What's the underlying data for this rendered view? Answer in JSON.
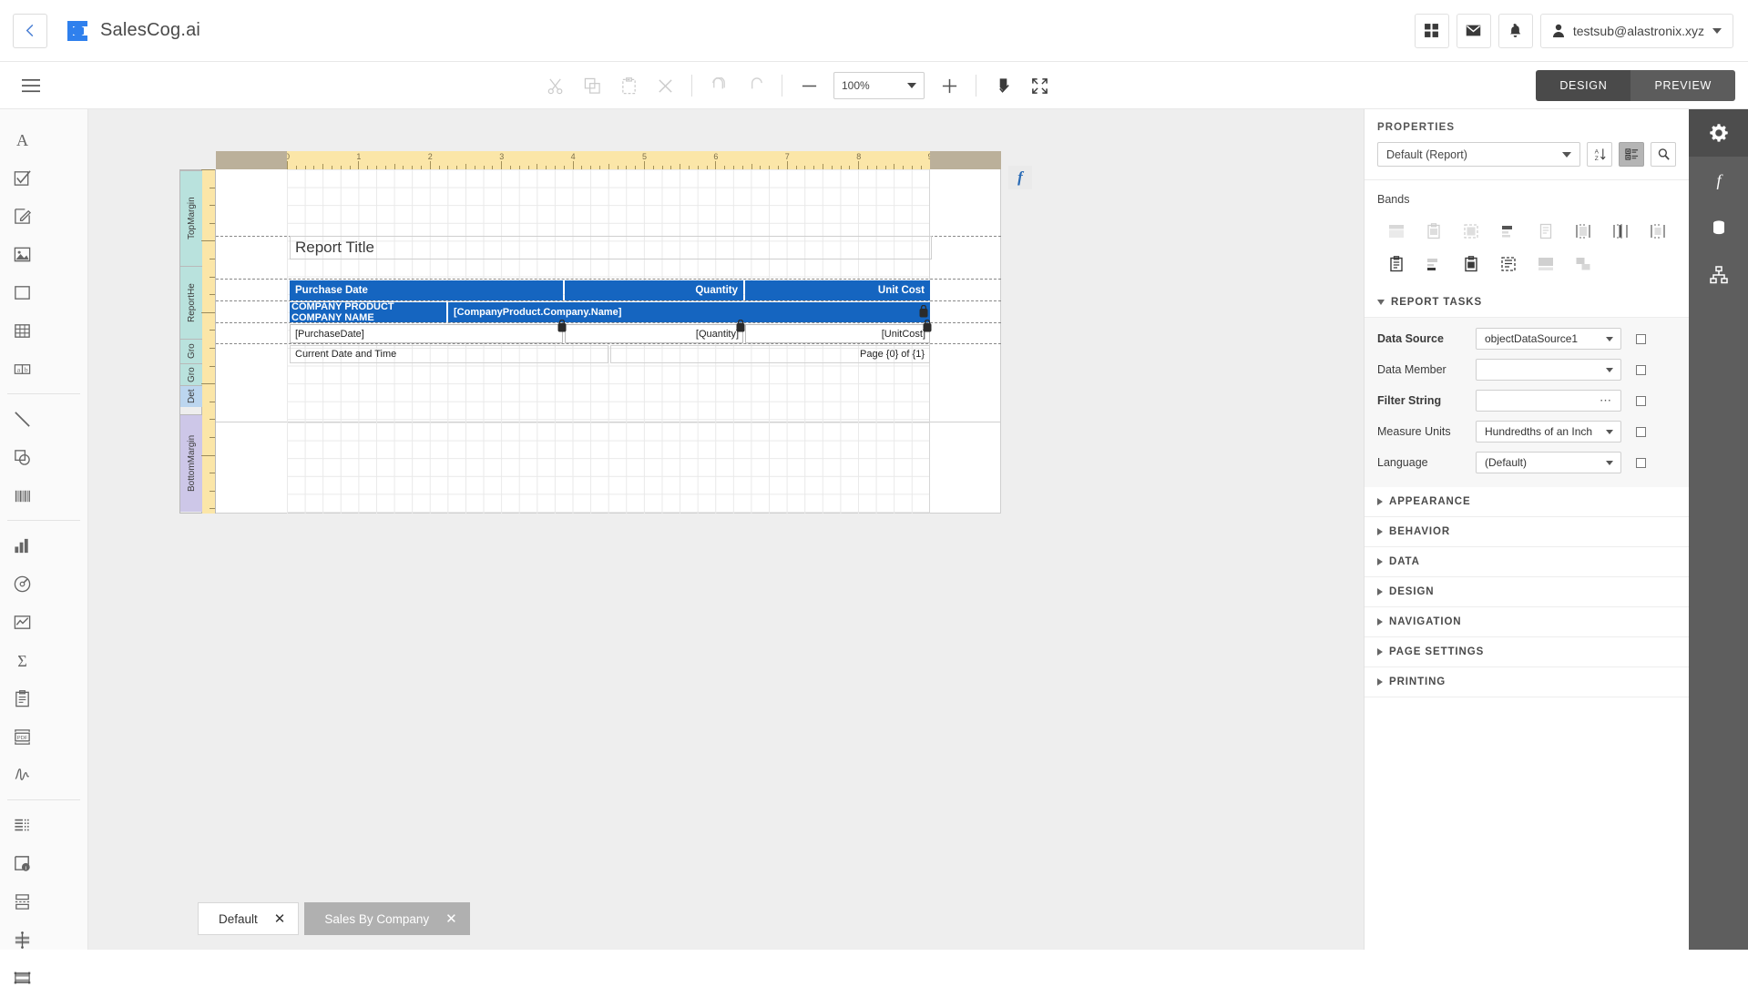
{
  "app": {
    "title": "SalesCog.ai",
    "back_icon": "chevron-left-icon",
    "logo_icon": "app-logo-icon"
  },
  "topbar": {
    "apps_icon": "apps-grid-icon",
    "mail_icon": "envelope-icon",
    "notifications_icon": "bell-icon",
    "user_icon": "user-avatar-icon",
    "user_email": "testsub@alastronix.xyz",
    "user_caret_icon": "chevron-down-icon"
  },
  "toolbar": {
    "menu_icon": "hamburger-menu-icon",
    "cut_icon": "scissors-icon",
    "copy_icon": "copy-icon",
    "paste_icon": "paste-icon",
    "delete_icon": "close-x-icon",
    "undo_icon": "undo-arrow-icon",
    "redo_icon": "redo-arrow-icon",
    "zoom_out_icon": "minus-icon",
    "zoom_value": "100%",
    "zoom_caret_icon": "chevron-down-icon",
    "zoom_in_icon": "plus-icon",
    "validate_icon": "validate-check-icon",
    "fullscreen_icon": "expand-fullscreen-icon",
    "design_label": "DESIGN",
    "preview_label": "PREVIEW",
    "active_mode": "DESIGN"
  },
  "left_rail": {
    "groups": [
      {
        "items": [
          {
            "icon": "label-text-icon",
            "name": "label-tool"
          },
          {
            "icon": "check-box-icon",
            "name": "check-box-tool"
          },
          {
            "icon": "rich-text-icon",
            "name": "rich-text-tool"
          },
          {
            "icon": "picture-box-icon",
            "name": "picture-box-tool"
          },
          {
            "icon": "panel-icon",
            "name": "panel-tool"
          },
          {
            "icon": "table-icon",
            "name": "table-tool"
          },
          {
            "icon": "character-comb-icon",
            "name": "character-comb-tool"
          }
        ]
      },
      {
        "items": [
          {
            "icon": "line-icon",
            "name": "line-tool"
          },
          {
            "icon": "shape-icon",
            "name": "shape-tool"
          },
          {
            "icon": "barcode-icon",
            "name": "barcode-tool"
          }
        ]
      },
      {
        "items": [
          {
            "icon": "bar-chart-icon",
            "name": "chart-tool"
          },
          {
            "icon": "gauge-icon",
            "name": "gauge-tool"
          },
          {
            "icon": "sparkline-icon",
            "name": "sparkline-tool"
          },
          {
            "icon": "sigma-icon",
            "name": "pivot-grid-tool"
          },
          {
            "icon": "clipboard-icon",
            "name": "subreport-tool"
          },
          {
            "icon": "pdf-content-icon",
            "name": "pdf-content-tool"
          },
          {
            "icon": "signature-icon",
            "name": "signature-tool"
          }
        ]
      },
      {
        "items": [
          {
            "icon": "table-of-contents-icon",
            "name": "table-of-contents-tool"
          },
          {
            "icon": "page-info-icon",
            "name": "page-info-tool"
          },
          {
            "icon": "page-break-icon",
            "name": "page-break-tool"
          },
          {
            "icon": "cross-band-line-icon",
            "name": "cross-band-line-tool"
          },
          {
            "icon": "cross-band-box-icon",
            "name": "cross-band-box-tool"
          }
        ]
      }
    ]
  },
  "designer": {
    "fx_button_label": "f",
    "fx_icon": "function-fx-icon",
    "ruler_h_marks": [
      "0",
      "1",
      "2",
      "3",
      "4",
      "5",
      "6",
      "7",
      "8",
      "9"
    ],
    "bands": [
      {
        "label": "TopMargin",
        "name": "band-top-margin"
      },
      {
        "label": "ReportHe",
        "name": "band-report-header"
      },
      {
        "label": "Gro",
        "name": "band-group-header-1"
      },
      {
        "label": "Gro",
        "name": "band-group-header-2"
      },
      {
        "label": "Det",
        "name": "band-detail"
      },
      {
        "label": "BottomMargin",
        "name": "band-bottom-margin"
      }
    ],
    "report_title": "Report Title",
    "column_headers": [
      "Purchase Date",
      "Quantity",
      "Unit Cost"
    ],
    "group_row": {
      "label": "COMPANY PRODUCT COMPANY NAME",
      "value": "[CompanyProduct.Company.Name]"
    },
    "detail_row": [
      "[PurchaseDate]",
      "[Quantity]",
      "[UnitCost]"
    ],
    "footer_row": [
      "Current Date and Time",
      "Page {0} of {1}"
    ],
    "accent_color": "#1565c0"
  },
  "tabs": {
    "items": [
      {
        "label": "Default",
        "active": true,
        "close_icon": "close-x-icon"
      },
      {
        "label": "Sales By Company",
        "active": false,
        "close_icon": "close-x-icon"
      }
    ],
    "fab_icon": "bell-icon"
  },
  "properties": {
    "panel_title": "PROPERTIES",
    "selected_object": "Default (Report)",
    "select_caret_icon": "chevron-down-icon",
    "sort_alpha_icon": "sort-alphabetical-icon",
    "categorized_icon": "categorized-view-icon",
    "search_icon": "search-icon",
    "bands_label": "Bands",
    "band_icons": [
      "top-margin-band-icon",
      "report-header-band-icon",
      "page-header-band-icon",
      "group-header-band-icon",
      "detail-band-icon",
      "group-footer-band-icon",
      "page-footer-band-icon",
      "report-footer-band-icon",
      "detail-report-band-icon",
      "sub-band-icon",
      "vertical-header-band-icon",
      "vertical-detail-band-icon",
      "bottom-margin-band-icon",
      "overlay-band-icon"
    ],
    "report_tasks": {
      "title": "REPORT TASKS",
      "expanded": true,
      "rows": [
        {
          "label": "Data Source",
          "value": "objectDataSource1",
          "control": "dropdown",
          "bold": true
        },
        {
          "label": "Data Member",
          "value": "",
          "control": "dropdown",
          "bold": false
        },
        {
          "label": "Filter String",
          "value": "",
          "control": "ellipsis",
          "bold": true
        },
        {
          "label": "Measure Units",
          "value": "Hundredths of an Inch",
          "control": "dropdown",
          "bold": false
        },
        {
          "label": "Language",
          "value": "(Default)",
          "control": "dropdown",
          "bold": false
        }
      ]
    },
    "sections": [
      {
        "title": "APPEARANCE"
      },
      {
        "title": "BEHAVIOR"
      },
      {
        "title": "DATA"
      },
      {
        "title": "DESIGN"
      },
      {
        "title": "NAVIGATION"
      },
      {
        "title": "PAGE SETTINGS"
      },
      {
        "title": "PRINTING"
      }
    ]
  },
  "right_rail": {
    "items": [
      {
        "icon": "gear-icon",
        "name": "properties-panel-button",
        "active": true
      },
      {
        "icon": "expressions-fx-icon",
        "name": "expressions-panel-button",
        "active": false
      },
      {
        "icon": "database-icon",
        "name": "field-list-panel-button",
        "active": false
      },
      {
        "icon": "report-explorer-icon",
        "name": "report-explorer-panel-button",
        "active": false
      }
    ]
  }
}
